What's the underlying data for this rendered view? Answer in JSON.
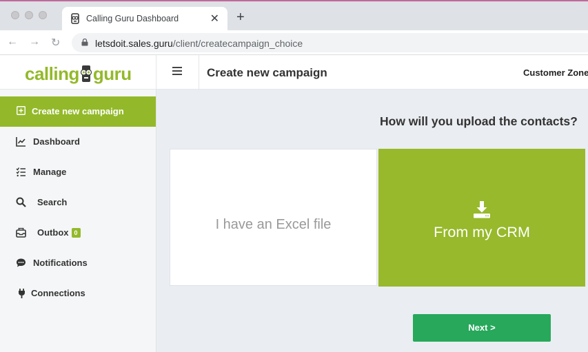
{
  "browser": {
    "tab_title": "Calling Guru Dashboard",
    "url_host": "letsdoit.sales.guru",
    "url_path": "/client/createcampaign_choice"
  },
  "header": {
    "logo_left": "calling",
    "logo_right": "guru",
    "page_title": "Create new campaign",
    "customer_zone": "Customer Zone"
  },
  "sidebar": {
    "items": [
      {
        "label": "Create new campaign",
        "icon": "plus-square-icon",
        "active": true
      },
      {
        "label": "Dashboard",
        "icon": "chart-line-icon"
      },
      {
        "label": "Manage",
        "icon": "checklist-icon"
      },
      {
        "label": "Search",
        "icon": "search-icon"
      },
      {
        "label": "Outbox",
        "icon": "inbox-icon",
        "badge": "0"
      },
      {
        "label": "Notifications",
        "icon": "comment-dots-icon"
      },
      {
        "label": "Connections",
        "icon": "plug-icon"
      }
    ]
  },
  "main": {
    "question": "How will you upload the contacts?",
    "option_excel": "I have an Excel file",
    "option_crm": "From my CRM",
    "next_label": "Next >"
  },
  "colors": {
    "brand_green": "#93b92a",
    "crm_green": "#97b92b",
    "next_green": "#27a85b"
  }
}
